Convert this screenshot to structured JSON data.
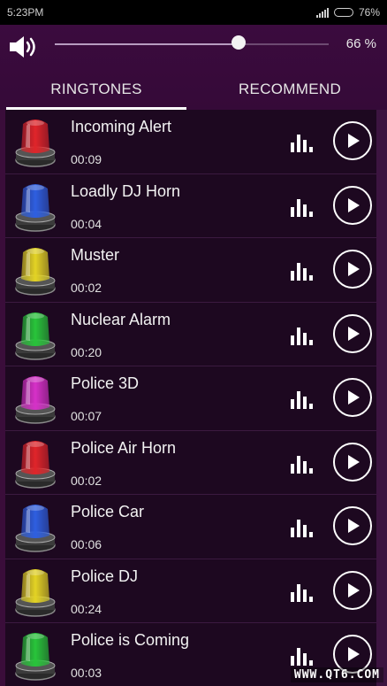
{
  "status": {
    "time": "5:23PM",
    "battery": "76%",
    "battery_level": 0.76
  },
  "volume": {
    "percent_label": "66 %",
    "level": 0.66
  },
  "tabs": [
    {
      "label": "RINGTONES",
      "active": true
    },
    {
      "label": "RECOMMEND",
      "active": false
    }
  ],
  "ringtones": [
    {
      "title": "Incoming Alert",
      "duration": "00:09",
      "color": "#e0252a"
    },
    {
      "title": "Loadly DJ Horn",
      "duration": "00:04",
      "color": "#2e5fe0"
    },
    {
      "title": "Muster",
      "duration": "00:02",
      "color": "#e3d324"
    },
    {
      "title": "Nuclear Alarm",
      "duration": "00:20",
      "color": "#28c43a"
    },
    {
      "title": "Police 3D",
      "duration": "00:07",
      "color": "#d631c8"
    },
    {
      "title": "Police Air Horn",
      "duration": "00:02",
      "color": "#e0252a"
    },
    {
      "title": "Police Car",
      "duration": "00:06",
      "color": "#2e5fe0"
    },
    {
      "title": "Police DJ",
      "duration": "00:24",
      "color": "#e3d324"
    },
    {
      "title": "Police is Coming",
      "duration": "00:03",
      "color": "#28c43a"
    }
  ],
  "icons": {
    "speaker": "volume-icon",
    "equalizer": "equalizer-icon",
    "play": "play-icon",
    "siren": "siren-light-icon"
  },
  "watermark": "WWW.QT6.COM"
}
